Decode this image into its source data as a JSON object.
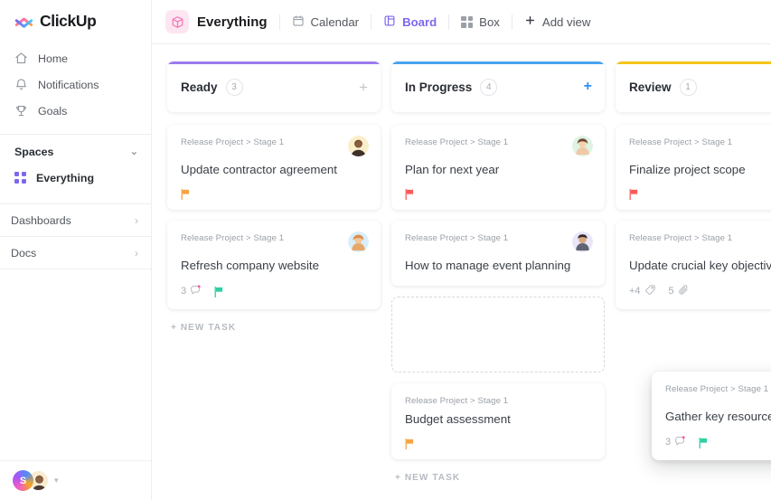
{
  "brand": {
    "name": "ClickUp",
    "accent": "#7b68ee"
  },
  "sidebar": {
    "nav": [
      {
        "label": "Home",
        "icon": "home-icon"
      },
      {
        "label": "Notifications",
        "icon": "bell-icon"
      },
      {
        "label": "Goals",
        "icon": "trophy-icon"
      }
    ],
    "spaces_label": "Spaces",
    "space_item": "Everything",
    "links": [
      {
        "label": "Dashboards"
      },
      {
        "label": "Docs"
      }
    ],
    "user_initial": "S"
  },
  "toolbar": {
    "view_title": "Everything",
    "views": [
      {
        "label": "Calendar",
        "icon": "calendar-icon",
        "active": false
      },
      {
        "label": "Board",
        "icon": "board-icon",
        "active": true
      },
      {
        "label": "Box",
        "icon": "box-grid-icon",
        "active": false
      }
    ],
    "add_view": "Add view"
  },
  "board": {
    "new_task_label": "+ NEW TASK",
    "columns": [
      {
        "name": "Ready",
        "count": "3",
        "accent": "#9b7bf0",
        "add_color": "#c3c7cd",
        "cards": [
          {
            "crumb": "Release Project > Stage 1",
            "title": "Update contractor agreement",
            "flag": "#f7a440",
            "comments": "",
            "avatar": "man-beard"
          },
          {
            "crumb": "Release Project > Stage 1",
            "title": "Refresh company website",
            "flag": "#2fd0a5",
            "comments": "3",
            "avatar": "woman-blonde"
          }
        ]
      },
      {
        "name": "In Progress",
        "count": "4",
        "accent": "#4aa3f0",
        "add_color": "#2e90fa",
        "cards": [
          {
            "crumb": "Release Project > Stage 1",
            "title": "Plan for next year",
            "flag": "#fb5a5a",
            "comments": "",
            "avatar": "woman-green"
          },
          {
            "crumb": "Release Project > Stage 1",
            "title": "How to manage event planning",
            "flag": "",
            "comments": "",
            "avatar": "man-purple"
          },
          {
            "crumb": "Release Project > Stage 1",
            "title": "Budget assessment",
            "flag": "#f7a440",
            "comments": "",
            "avatar": ""
          }
        ]
      },
      {
        "name": "Review",
        "count": "1",
        "accent": "#f5c518",
        "add_color": "#c3c7cd",
        "cards": [
          {
            "crumb": "Release Project > Stage 1",
            "title": "Finalize project scope",
            "flag": "#fb5a5a",
            "comments": "",
            "avatar": "man-beard2"
          },
          {
            "crumb": "Release Project > Stage 1",
            "title": "Update crucial key objectives",
            "flag": "",
            "tags": "+4",
            "attachments": "5",
            "avatar": "man-dark"
          }
        ]
      }
    ],
    "dragging_card": {
      "crumb": "Release Project > Stage 1",
      "title": "Gather key resources",
      "comments": "3",
      "flag": "#2fd0a5",
      "avatar": "woman-blonde"
    },
    "cursor": "move-cursor"
  }
}
